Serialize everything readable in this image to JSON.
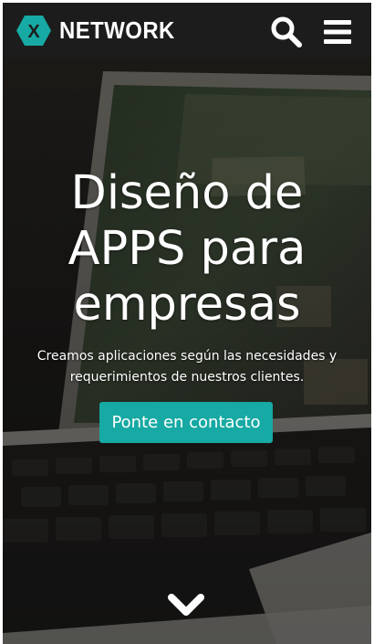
{
  "header": {
    "brand_name": "NETWORK",
    "logo_letter": "X"
  },
  "hero": {
    "headline_lines": [
      "Diseño de",
      "APPS para",
      "empresas"
    ],
    "subtitle": "Creamos aplicaciones según las necesidades y requerimientos de nuestros clientes.",
    "cta_label": "Ponte en contacto",
    "background_image": "laptop-keyboard-photo"
  },
  "icons": {
    "logo": "hexagon-logo-icon",
    "search": "search-icon",
    "menu": "hamburger-menu-icon",
    "scroll": "chevron-down-icon"
  },
  "colors": {
    "accent": "#17a9a3",
    "header_bg": "#1c1c1c",
    "text": "#ffffff"
  }
}
